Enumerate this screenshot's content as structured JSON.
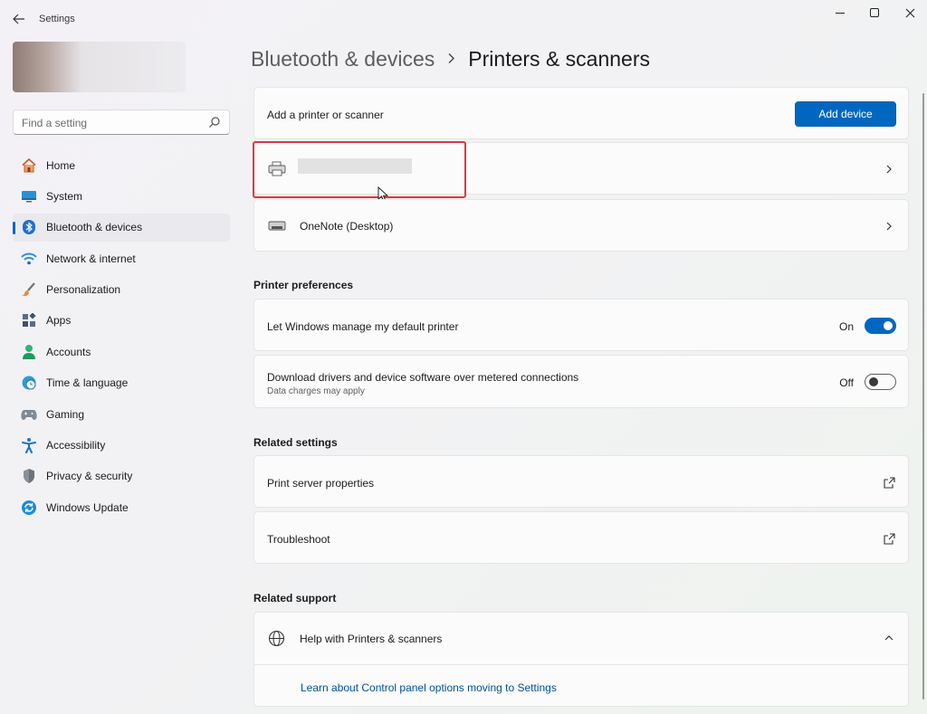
{
  "window": {
    "title": "Settings"
  },
  "sidebar": {
    "search_placeholder": "Find a setting",
    "items": [
      {
        "label": "Home",
        "icon": "home-icon"
      },
      {
        "label": "System",
        "icon": "system-icon"
      },
      {
        "label": "Bluetooth & devices",
        "icon": "bluetooth-icon",
        "active": true
      },
      {
        "label": "Network & internet",
        "icon": "wifi-icon"
      },
      {
        "label": "Personalization",
        "icon": "brush-icon"
      },
      {
        "label": "Apps",
        "icon": "apps-icon"
      },
      {
        "label": "Accounts",
        "icon": "accounts-icon"
      },
      {
        "label": "Time & language",
        "icon": "globe-clock-icon"
      },
      {
        "label": "Gaming",
        "icon": "gamepad-icon"
      },
      {
        "label": "Accessibility",
        "icon": "accessibility-icon"
      },
      {
        "label": "Privacy & security",
        "icon": "shield-icon"
      },
      {
        "label": "Windows Update",
        "icon": "update-icon"
      }
    ]
  },
  "breadcrumb": {
    "parent": "Bluetooth & devices",
    "separator": ">",
    "current": "Printers & scanners"
  },
  "add_printer": {
    "label": "Add a printer or scanner",
    "button": "Add device"
  },
  "printers": [
    {
      "label": ""
    },
    {
      "label": "OneNote (Desktop)"
    }
  ],
  "printer_preferences": {
    "title": "Printer preferences",
    "default_printer": {
      "label": "Let Windows manage my default printer",
      "state": "On"
    },
    "metered": {
      "label": "Download drivers and device software over metered connections",
      "sublabel": "Data charges may apply",
      "state": "Off"
    }
  },
  "related_settings": {
    "title": "Related settings",
    "items": [
      "Print server properties",
      "Troubleshoot"
    ]
  },
  "related_support": {
    "title": "Related support",
    "help_label": "Help with Printers & scanners",
    "link": "Learn about Control panel options moving to Settings"
  },
  "colors": {
    "accent": "#0067c0",
    "highlight": "#e0363c"
  }
}
